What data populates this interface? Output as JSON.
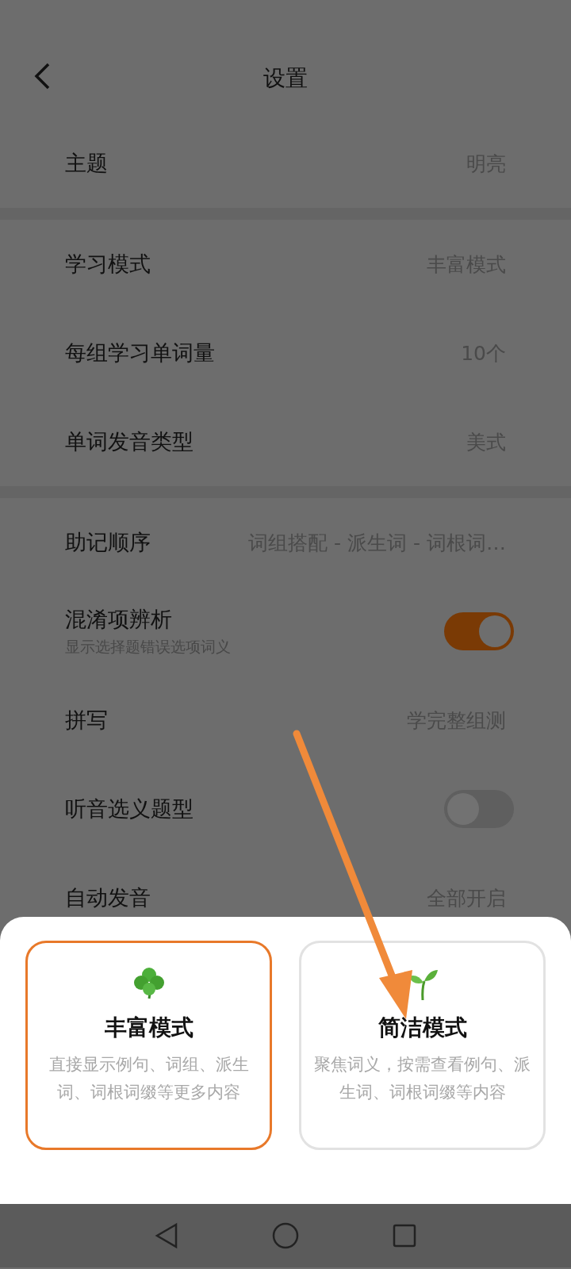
{
  "header": {
    "title": "设置"
  },
  "groups": [
    {
      "rows": [
        {
          "kind": "value",
          "label": "主题",
          "value": "明亮"
        }
      ]
    },
    {
      "rows": [
        {
          "kind": "value",
          "label": "学习模式",
          "value": "丰富模式"
        },
        {
          "kind": "value",
          "label": "每组学习单词量",
          "value": "10个"
        },
        {
          "kind": "value",
          "label": "单词发音类型",
          "value": "美式"
        }
      ]
    },
    {
      "rows": [
        {
          "kind": "value",
          "label": "助记顺序",
          "value": "词组搭配 - 派生词 - 词根词…"
        },
        {
          "kind": "toggle",
          "label": "混淆项辨析",
          "subtitle": "显示选择题错误选项词义",
          "on": true
        },
        {
          "kind": "value",
          "label": "拼写",
          "value": "学完整组测"
        },
        {
          "kind": "toggle",
          "label": "听音选义题型",
          "on": false
        },
        {
          "kind": "value",
          "label": "自动发音",
          "value": "全部开启"
        }
      ]
    }
  ],
  "sheet": {
    "cards": [
      {
        "kind": "clover",
        "title": "丰富模式",
        "description": "直接显示例句、词组、派生词、词根词缀等更多内容",
        "selected": true
      },
      {
        "kind": "sprout",
        "title": "简洁模式",
        "description": "聚焦词义，按需查看例句、派生词、词根词缀等内容",
        "selected": false
      }
    ]
  }
}
